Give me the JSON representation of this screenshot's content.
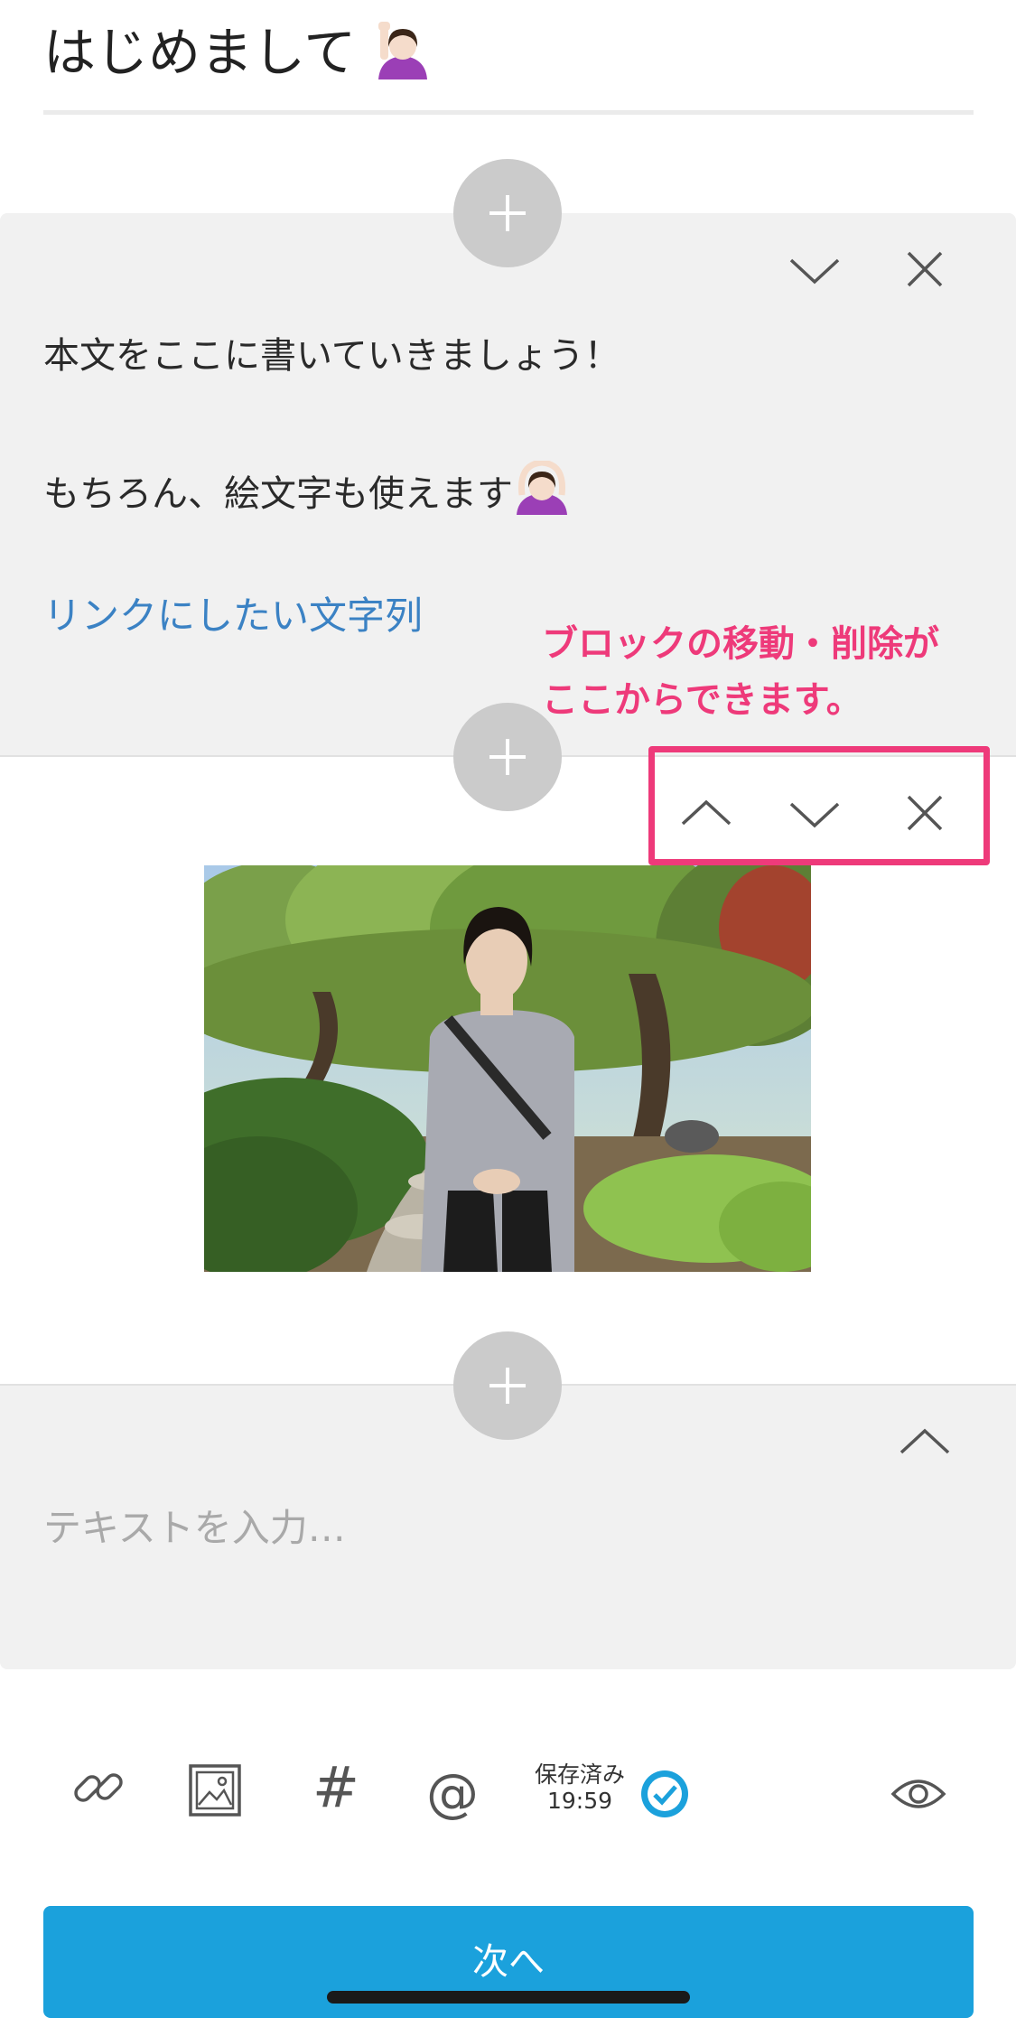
{
  "editor": {
    "title": "はじめまして",
    "title_emoji": "person-raising-hand-emoji"
  },
  "text_block": {
    "line1": "本文をここに書いていきましょう！",
    "line2": "もちろん、絵文字も使えます",
    "line2_emoji": "person-gesturing-ok-emoji",
    "link_text": "リンクにしたい文字列"
  },
  "annotation": {
    "line1": "ブロックの移動・削除が",
    "line2": "ここからできます。",
    "color": "#ee3a7a"
  },
  "image_block": {
    "photo": "portrait-in-japanese-garden"
  },
  "input_block": {
    "placeholder": "テキストを入力…"
  },
  "toolbar": {
    "icons": [
      "link-icon",
      "image-icon",
      "hashtag-icon",
      "mention-icon",
      "saved-check-icon",
      "preview-eye-icon"
    ],
    "hashtag_symbol": "#",
    "mention_symbol": "@",
    "save_status": "保存済み",
    "save_time": "19:59"
  },
  "footer": {
    "next_label": "次へ"
  },
  "colors": {
    "accent": "#1ba1dc",
    "link": "#3b82c4",
    "block_bg": "#f1f1f1",
    "add_button": "#cbcbcb"
  }
}
